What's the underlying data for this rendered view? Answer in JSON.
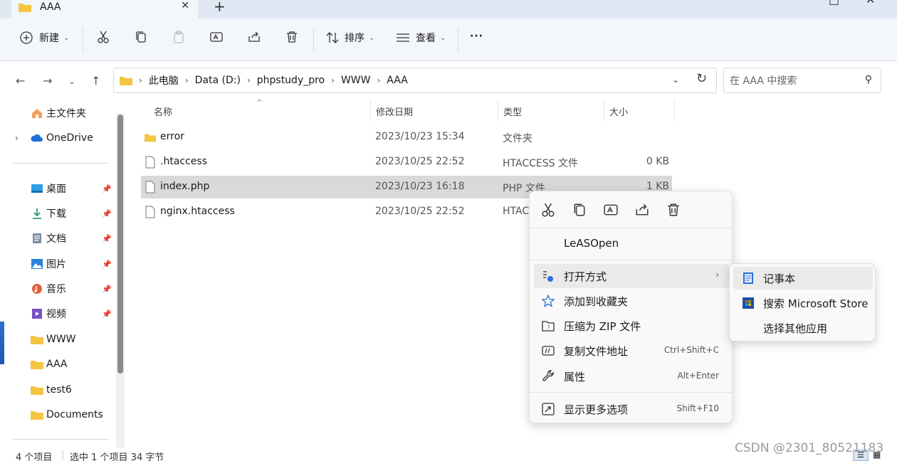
{
  "window": {
    "tab_title": "AAA"
  },
  "toolbar": {
    "new_label": "新建",
    "sort_label": "排序",
    "view_label": "查看",
    "more_label": "···"
  },
  "address": {
    "crumbs": [
      "此电脑",
      "Data (D:)",
      "phpstudy_pro",
      "WWW",
      "AAA"
    ],
    "search_placeholder": "在 AAA 中搜索"
  },
  "sidebar": {
    "items": [
      {
        "label": "主文件夹",
        "icon": "home-icon"
      },
      {
        "label": "OneDrive",
        "icon": "cloud-icon"
      },
      {
        "label": "桌面",
        "icon": "desktop-icon"
      },
      {
        "label": "下载",
        "icon": "download-icon"
      },
      {
        "label": "文档",
        "icon": "document-icon"
      },
      {
        "label": "图片",
        "icon": "pictures-icon"
      },
      {
        "label": "音乐",
        "icon": "music-icon"
      },
      {
        "label": "视频",
        "icon": "video-icon"
      },
      {
        "label": "WWW",
        "icon": "folder-icon"
      },
      {
        "label": "AAA",
        "icon": "folder-icon"
      },
      {
        "label": "test6",
        "icon": "folder-icon"
      },
      {
        "label": "Documents",
        "icon": "folder-icon"
      }
    ]
  },
  "list": {
    "columns": [
      "名称",
      "修改日期",
      "类型",
      "大小"
    ],
    "rows": [
      {
        "name": "error",
        "date": "2023/10/23 15:34",
        "type": "文件夹",
        "size": ""
      },
      {
        "name": ".htaccess",
        "date": "2023/10/25 22:52",
        "type": "HTACCESS 文件",
        "size": "0 KB"
      },
      {
        "name": "index.php",
        "date": "2023/10/23 16:18",
        "type": "PHP 文件",
        "size": "1 KB"
      },
      {
        "name": "nginx.htaccess",
        "date": "2023/10/25 22:52",
        "type": "HTAC",
        "size": ""
      }
    ]
  },
  "context_menu": {
    "items": [
      {
        "label": "LeASOpen",
        "shortcut": ""
      },
      {
        "label": "打开方式",
        "shortcut": ""
      },
      {
        "label": "添加到收藏夹",
        "shortcut": ""
      },
      {
        "label": "压缩为 ZIP 文件",
        "shortcut": ""
      },
      {
        "label": "复制文件地址",
        "shortcut": "Ctrl+Shift+C"
      },
      {
        "label": "属性",
        "shortcut": "Alt+Enter"
      },
      {
        "label": "显示更多选项",
        "shortcut": "Shift+F10"
      }
    ]
  },
  "submenu": {
    "items": [
      {
        "label": "记事本"
      },
      {
        "label": "搜索 Microsoft Store"
      },
      {
        "label": "选择其他应用"
      }
    ]
  },
  "status": {
    "count": "4 个项目",
    "selection": "选中 1 个项目  34 字节"
  },
  "watermark": "CSDN @2301_80521183",
  "colors": {
    "accent": "#0067c0",
    "folder": "#f4c542",
    "selection": "#d9d9d9"
  }
}
